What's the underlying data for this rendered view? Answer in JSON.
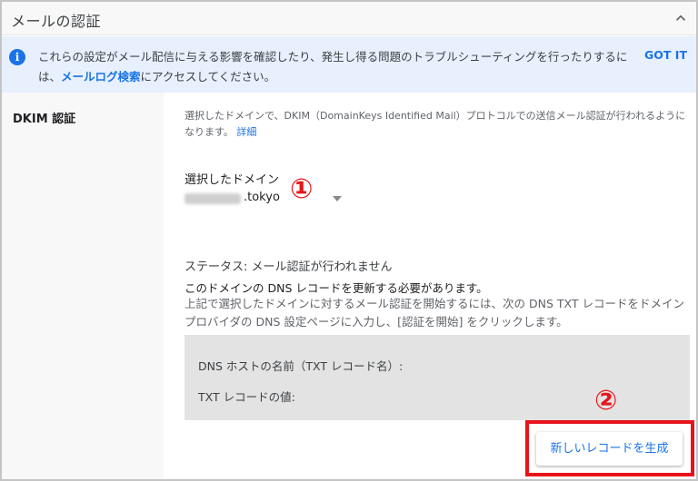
{
  "header": {
    "title": "メールの認証",
    "collapse_icon": "chevron-up-icon"
  },
  "banner": {
    "icon": "info-icon",
    "icon_glyph": "i",
    "text_before": "これらの設定がメール配信に与える影響を確認したり、発生し得る問題のトラブルシューティングを行ったりするに",
    "text_prefix2": "は、",
    "link": "メールログ検索",
    "text_after": "にアクセスしてください。",
    "dismiss_label": "GOT IT",
    "background": "#e8f0fe",
    "accent": "#1a73e8"
  },
  "section": {
    "label": "DKIM 認証",
    "description": "選択したドメインで、DKIM（DomainKeys Identified Mail）プロトコルでの送信メール認証が行われるようになります。",
    "details_link": "詳細"
  },
  "domain": {
    "label": "選択したドメイン",
    "value": ".tokyo"
  },
  "status": {
    "text": "ステータス: メール認証が行われません"
  },
  "notice": {
    "text": "このドメインの DNS レコードを更新する必要があります。",
    "instruction": "上記で選択したドメインに対するメール認証を開始するには、次の DNS TXT レコードをドメイン プロバイダの DNS 設定ページに入力し、[認証を開始] をクリックします。"
  },
  "dns": {
    "host_label": "DNS ホストの名前（TXT レコード名）:",
    "txt_label": "TXT レコードの値:"
  },
  "annotations": {
    "badge1": "①",
    "badge2": "②",
    "highlight_color": "#e8141b"
  },
  "actions": {
    "generate_label": "新しいレコードを生成"
  }
}
